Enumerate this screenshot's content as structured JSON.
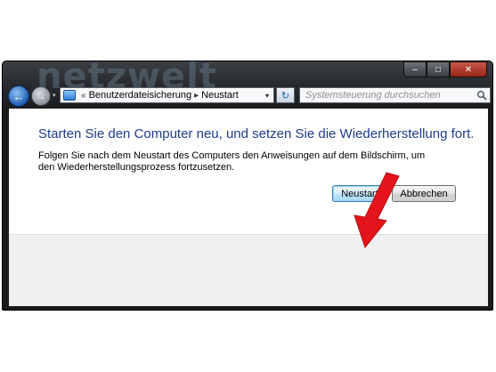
{
  "watermark": "netzwelt",
  "window_controls": {
    "minimize": "–",
    "maximize": "□",
    "close": "✕"
  },
  "nav": {
    "back": "←",
    "forward": "→",
    "dropdown": "▾"
  },
  "addressbar": {
    "prefix": "«",
    "items": [
      "Benutzerdateisicherung",
      "Neustart"
    ],
    "separator": "▸",
    "dropdown": "▾"
  },
  "refresh": "↻",
  "search": {
    "placeholder": "Systemsteuerung durchsuchen"
  },
  "main": {
    "heading": "Starten Sie den Computer neu, und setzen Sie die Wiederherstellung fort.",
    "description": "Folgen Sie nach dem Neustart des Computers den Anweisungen auf dem Bildschirm, um den Wiederherstellungsprozess fortzusetzen."
  },
  "buttons": {
    "restart": "Neustart",
    "cancel": "Abbrechen"
  },
  "colors": {
    "heading": "#1e3c8c",
    "annotation_arrow": "#e3141b",
    "titlebar": "#2a2c30"
  }
}
